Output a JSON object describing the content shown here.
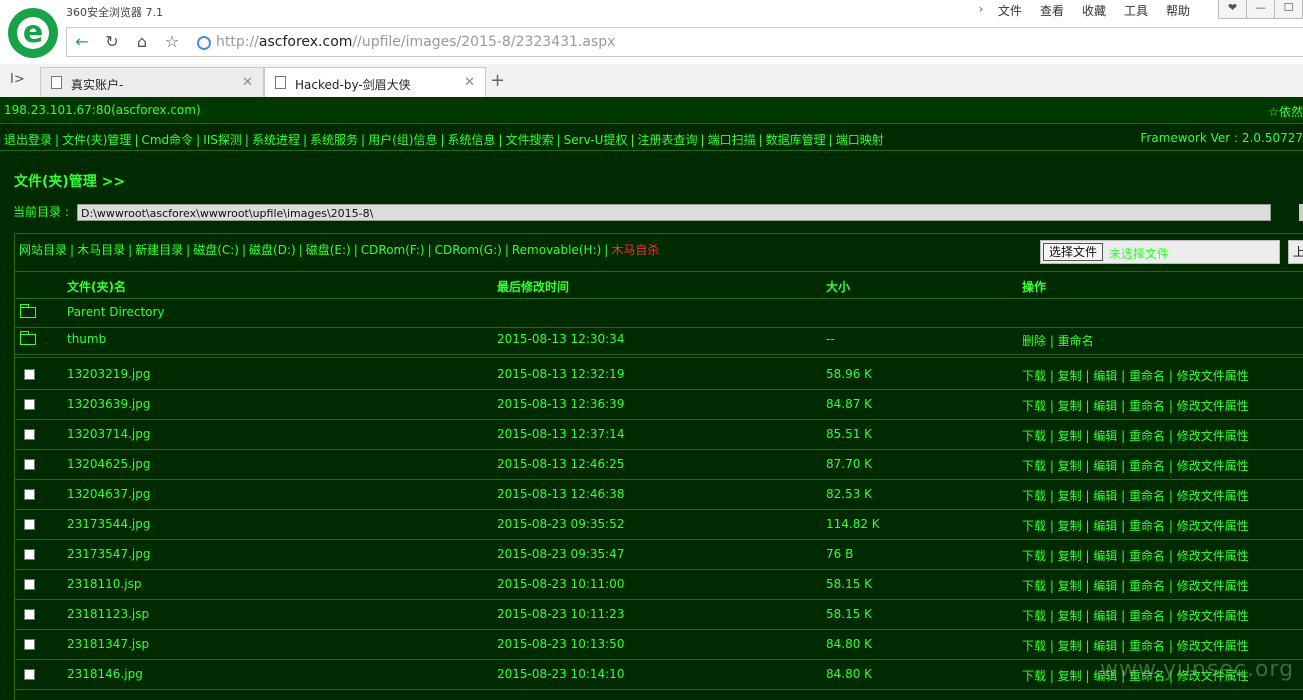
{
  "browser": {
    "app_title": "360安全浏览器 7.1",
    "menu": [
      "文件",
      "查看",
      "收藏",
      "工具",
      "帮助"
    ],
    "window_buttons": [
      "❤",
      "—",
      "☐"
    ],
    "url": {
      "scheme": "http://",
      "host": "ascforex.com",
      "path": "//upfile/images/2015-8/2323431.aspx"
    },
    "tabs": [
      {
        "label": "真实账户-"
      },
      {
        "label": "Hacked-by-剑眉大侠"
      }
    ]
  },
  "page": {
    "host_info": "198.23.101.67:80(ascforex.com)",
    "host_right": "☆依然",
    "tools": [
      "退出登录",
      "文件(夹)管理",
      "Cmd命令",
      "IIS探测",
      "系统进程",
      "系统服务",
      "用户(组)信息",
      "系统信息",
      "文件搜索",
      "Serv-U提权",
      "注册表查询",
      "端口扫描",
      "数据库管理",
      "端口映射"
    ],
    "framework": "Framework Ver : 2.0.50727",
    "section_title": "文件(夹)管理 >>",
    "current_dir_label": "当前目录 :",
    "current_dir": "D:\\wwwroot\\ascforex\\wwwroot\\upfile\\images\\2015-8\\",
    "drives": [
      "网站目录",
      "木马目录",
      "新建目录",
      "磁盘(C:)",
      "磁盘(D:)",
      "磁盘(E:)",
      "CDRom(F:)",
      "CDRom(G:)",
      "Removable(H:)"
    ],
    "drives_danger": "木马自杀",
    "upload": {
      "choose_label": "选择文件",
      "no_file": "未选择文件",
      "upload_label": "上"
    },
    "headers": {
      "name": "文件(夹)名",
      "time": "最后修改时间",
      "size": "大小",
      "ops": "操作"
    },
    "parent_dir": "Parent Directory",
    "folders": [
      {
        "name": "thumb",
        "time": "2015-08-13 12:30:34",
        "size": "--",
        "ops": "删除 | 重命名"
      }
    ],
    "file_ops": "下载 | 复制 | 编辑 | 重命名 | 修改文件属性",
    "files": [
      {
        "name": "13203219.jpg",
        "time": "2015-08-13 12:32:19",
        "size": "58.96 K"
      },
      {
        "name": "13203639.jpg",
        "time": "2015-08-13 12:36:39",
        "size": "84.87 K"
      },
      {
        "name": "13203714.jpg",
        "time": "2015-08-13 12:37:14",
        "size": "85.51 K"
      },
      {
        "name": "13204625.jpg",
        "time": "2015-08-13 12:46:25",
        "size": "87.70 K"
      },
      {
        "name": "13204637.jpg",
        "time": "2015-08-13 12:46:38",
        "size": "82.53 K"
      },
      {
        "name": "23173544.jpg",
        "time": "2015-08-23 09:35:52",
        "size": "114.82 K"
      },
      {
        "name": "23173547.jpg",
        "time": "2015-08-23 09:35:47",
        "size": "76 B"
      },
      {
        "name": "2318110.jsp",
        "time": "2015-08-23 10:11:00",
        "size": "58.15 K"
      },
      {
        "name": "23181123.jsp",
        "time": "2015-08-23 10:11:23",
        "size": "58.15 K"
      },
      {
        "name": "23181347.jsp",
        "time": "2015-08-23 10:13:50",
        "size": "84.80 K"
      },
      {
        "name": "2318146.jpg",
        "time": "2015-08-23 10:14:10",
        "size": "84.80 K"
      }
    ],
    "watermark": "www.yunsec.org",
    "colors": {
      "bg": "#002a00",
      "text": "#33ff33",
      "danger": "#ff2a2a",
      "border": "#1e6a1e"
    }
  }
}
